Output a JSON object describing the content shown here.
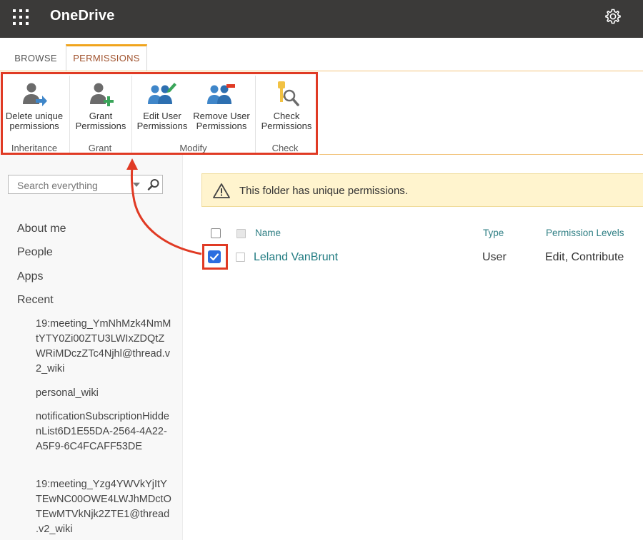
{
  "suite_bar": {
    "app_title": "OneDrive",
    "background": "#3b3a39",
    "waffle_icon": "app-launcher-icon",
    "settings_icon": "gear-icon"
  },
  "ribbon": {
    "tabs": [
      {
        "label": "BROWSE",
        "selected": false
      },
      {
        "label": "PERMISSIONS",
        "selected": true
      }
    ],
    "accent_color": "#f0a41c",
    "buttons": {
      "delete_unique": {
        "line1": "Delete unique",
        "line2": "permissions",
        "icon": "user-arrow-icon"
      },
      "grant": {
        "line1": "Grant",
        "line2": "Permissions",
        "icon": "user-add-icon"
      },
      "edit_user": {
        "line1": "Edit User",
        "line2": "Permissions",
        "icon": "users-edit-icon"
      },
      "remove_user": {
        "line1": "Remove User",
        "line2": "Permissions",
        "icon": "users-remove-icon"
      },
      "check": {
        "line1": "Check",
        "line2": "Permissions",
        "icon": "key-search-icon"
      }
    },
    "groups": {
      "inheritance": "Inheritance",
      "grant": "Grant",
      "modify": "Modify",
      "check": "Check"
    },
    "highlight_color": "#e03a24"
  },
  "left_nav": {
    "search_placeholder": "Search everything",
    "items": [
      {
        "label": "About me"
      },
      {
        "label": "People"
      },
      {
        "label": "Apps"
      },
      {
        "label": "Recent"
      }
    ],
    "recent": [
      {
        "label": "19:meeting_YmNhMzk4NmMtYTY0Zi00ZTU3LWIxZDQtZWRiMDczZTc4Njhl@thread.v2_wiki"
      },
      {
        "label": "personal_wiki"
      },
      {
        "label": "notificationSubscriptionHiddenList6D1E55DA-2564-4A22-A5F9-6C4FCAFF53DE"
      },
      {
        "label": "19:meeting_Yzg4YWVkYjItYTEwNC00OWE4LWJhMDctOTEwMTVkNjk2ZTE1@thread.v2_wiki"
      }
    ]
  },
  "main": {
    "alert_text": "This folder has unique permissions.",
    "alert_icon": "warning-icon",
    "columns": {
      "name": "Name",
      "type": "Type",
      "permission_levels": "Permission Levels"
    },
    "rows": [
      {
        "name": "Leland VanBrunt",
        "type": "User",
        "permission_levels": "Edit, Contribute",
        "checked": true
      }
    ]
  }
}
